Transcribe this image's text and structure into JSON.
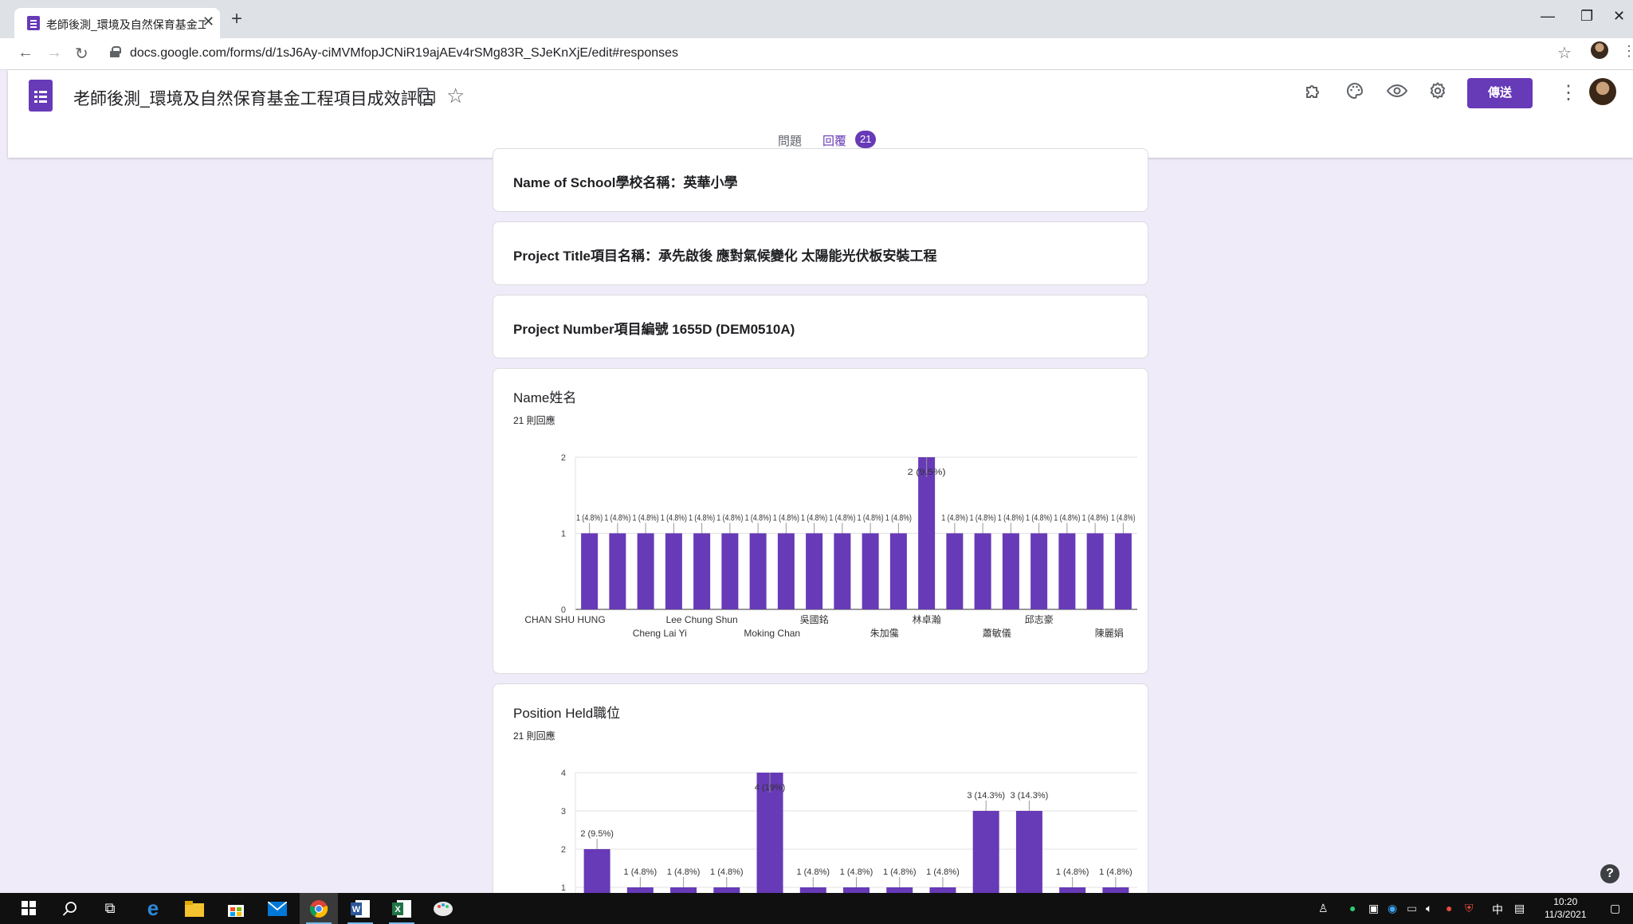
{
  "browser": {
    "tab_title": "老師後測_環境及自然保育基金工",
    "url": "docs.google.com/forms/d/1sJ6Ay-ciMVMfopJCNiR19ajAEv4rSMg83R_SJeKnXjE/edit#responses"
  },
  "form": {
    "title": "老師後測_環境及自然保育基金工程項目成效評估",
    "send_label": "傳送",
    "tabs": {
      "questions": "問題",
      "responses": "回覆",
      "responses_count": "21"
    }
  },
  "cards": {
    "school": "Name of School學校名稱：英華小學",
    "project_title": "Project Title項目名稱：承先啟後 應對氣候變化 太陽能光伏板安裝工程",
    "project_number": "Project Number項目編號 1655D (DEM0510A)",
    "name_q": "Name姓名",
    "name_count": "21 則回應",
    "position_q": "Position Held職位",
    "position_count": "21 則回應"
  },
  "chart_data": [
    {
      "type": "bar",
      "title": "Name姓名",
      "visible_x_labels": [
        "CHAN SHU HUNG",
        "Cheng Lai Yi",
        "Lee Chung Shun",
        "Moking Chan",
        "吳國銘",
        "朱加儳",
        "林卓瀚",
        "蕭敏儀",
        "邱志豪",
        "陳麗娟"
      ],
      "values": [
        1,
        1,
        1,
        1,
        1,
        1,
        1,
        1,
        1,
        1,
        1,
        1,
        2,
        1,
        1,
        1,
        1,
        1,
        1,
        1
      ],
      "data_labels": [
        "1 (4.8%)",
        "1 (4.8%)",
        "1 (4.8%)",
        "1 (4.8%)",
        "1 (4.8%)",
        "1 (4.8%)",
        "1 (4.8%)",
        "1 (4.8%)",
        "1 (4.8%)",
        "1 (4.8%)",
        "1 (4.8%)",
        "1 (4.8%)",
        "2 (9.5%)",
        "1 (4.8%)",
        "1 (4.8%)",
        "1 (4.8%)",
        "1 (4.8%)",
        "1 (4.8%)",
        "1 (4.8%)",
        "1 (4.8%)"
      ],
      "ylim": [
        0,
        2
      ],
      "yticks": [
        "0",
        "1",
        "2"
      ],
      "color": "#673ab7"
    },
    {
      "type": "bar",
      "title": "Position Held職位",
      "values": [
        2,
        1,
        1,
        1,
        4,
        1,
        1,
        1,
        1,
        3,
        3,
        1,
        1
      ],
      "data_labels": [
        "2 (9.5%)",
        "1 (4.8%)",
        "1 (4.8%)",
        "1 (4.8%)",
        "4 (19%)",
        "1 (4.8%)",
        "1 (4.8%)",
        "1 (4.8%)",
        "1 (4.8%)",
        "3 (14.3%)",
        "3 (14.3%)",
        "1 (4.8%)",
        "1 (4.8%)"
      ],
      "ylim": [
        0,
        4
      ],
      "yticks": [
        "1",
        "2",
        "3",
        "4"
      ],
      "color": "#673ab7"
    }
  ],
  "taskbar": {
    "time": "10:20",
    "date": "11/3/2021",
    "ime": "中"
  }
}
